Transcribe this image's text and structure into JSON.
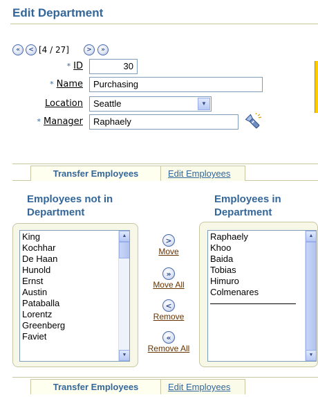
{
  "page": {
    "title": "Edit Department"
  },
  "pager": {
    "position": "[4 / 27]"
  },
  "form": {
    "required_marker": "*",
    "id_label": "ID",
    "id_value": "30",
    "name_label": "Name",
    "name_value": "Purchasing",
    "location_label": "Location",
    "location_value": "Seattle",
    "manager_label": "Manager",
    "manager_value": "Raphaely"
  },
  "tabs": [
    {
      "label": "Transfer Employees",
      "active": true
    },
    {
      "label": "Edit Employees",
      "active": false
    }
  ],
  "shuttle": {
    "left_header_1": "Employees not in",
    "left_header_2": "Department",
    "right_header_1": "Employees in",
    "right_header_2": "Department",
    "left_items": [
      "King",
      "Kochhar",
      "De Haan",
      "Hunold",
      "Ernst",
      "Austin",
      "Pataballa",
      "Lorentz",
      "Greenberg",
      "Faviet"
    ],
    "right_items": [
      "Raphaely",
      "Khoo",
      "Baida",
      "Tobias",
      "Himuro",
      "Colmenares"
    ],
    "move_label": "Move",
    "move_all_label": "Move All",
    "remove_label": "Remove",
    "remove_all_label": "Remove All"
  },
  "icons": {
    "first": "first-record-icon",
    "prev": "previous-record-icon",
    "next": "next-record-icon",
    "last": "last-record-icon",
    "lov": "flashlight-search-icon"
  },
  "colors": {
    "accent": "#336699",
    "link": "#663300",
    "rule": "#c6c6a0",
    "highlight": "#ffcc00"
  }
}
